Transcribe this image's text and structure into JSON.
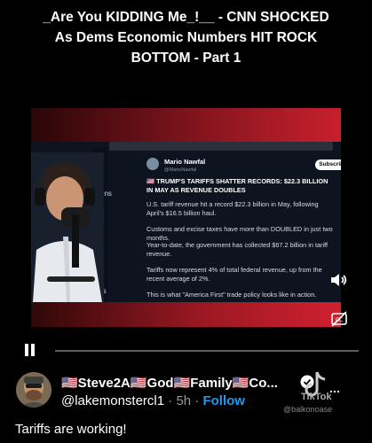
{
  "title": "_Are You KIDDING Me_!__ - CNN SHOCKED As Dems Economic Numbers HIT ROCK BOTTOM - Part 1",
  "video": {
    "sidebar_labels": [
      "tions",
      "es",
      "rks"
    ],
    "tweet": {
      "name": "Mario Nawfal",
      "handle": "@MarioNawfal",
      "subscribe_label": "Subscribe",
      "headline": "🇺🇸 TRUMP'S TARIFFS SHATTER RECORDS: $22.3 BILLION IN MAY AS REVENUE DOUBLES",
      "p1": "U.S. tariff revenue hit a record $22.3 billion in May, following April's $16.5 billion haul.",
      "p2": "Customs and excise taxes have more than DOUBLED in just two months.",
      "p3": "Year-to-date, the government has collected $67.2 billion in tariff revenue.",
      "p4": "Tariffs now represent 4% of total federal revenue, up from the recent average of 2%.",
      "p5": "This is what \"America First\" trade policy looks like in action."
    },
    "icons": {
      "volume": "volume-icon",
      "captions": "captions-off-icon"
    }
  },
  "controls": {
    "state": "playing",
    "progress": 0.0
  },
  "author": {
    "display_name": "🇺🇸Steve2A🇺🇸God🇺🇸Family🇺🇸Co...",
    "handle": "@lakemonstercl1",
    "time": "5h",
    "separator": "·",
    "follow_label": "Follow"
  },
  "watermark": {
    "brand": "TikTok",
    "user": "@balkonoase"
  },
  "caption": "Tariffs are working!"
}
